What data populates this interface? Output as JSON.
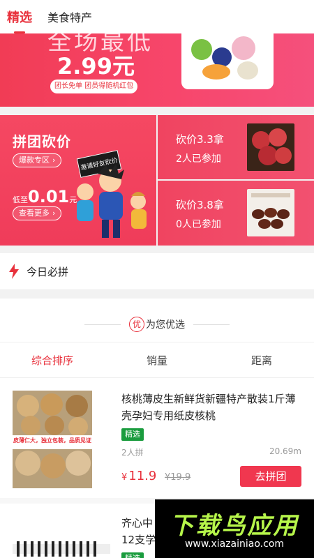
{
  "tabs": [
    {
      "label": "精选"
    },
    {
      "label": "美食特产"
    }
  ],
  "banner": {
    "headline": "全场最低",
    "price": "2.99元",
    "tag": "团长免单 团员得随机红包"
  },
  "group_cut": {
    "title": "拼团砍价",
    "zone_label": "爆款专区",
    "invite_label": "邀请好友砍价",
    "low_prefix": "低至",
    "low_price": "0.01",
    "low_unit": "元",
    "more_label": "查看更多",
    "items": [
      {
        "price": "砍价3.3拿",
        "joined": "2人已参加"
      },
      {
        "price": "砍价3.8拿",
        "joined": "0人已参加"
      }
    ]
  },
  "today": {
    "label": "今日必拼"
  },
  "foryou": {
    "badge": "优",
    "title": "为您优选"
  },
  "sort": [
    "综合排序",
    "销量",
    "距离"
  ],
  "products": [
    {
      "title": "核桃薄皮生新鲜货新疆特产散装1斤薄壳孕妇专用纸皮核桃",
      "tag": "精选",
      "group_size": "2人拼",
      "distance": "20.69m",
      "currency": "¥",
      "price": "11.9",
      "old_price": "¥19.9",
      "button": "去拼团",
      "thumb_caption": "皮薄仁大，独立包装，品质见证"
    },
    {
      "title": "齐心中\n12支学",
      "tag": "精选"
    }
  ],
  "watermark": {
    "title": "下载鸟应用",
    "url": "www.xiazainiao.com"
  }
}
